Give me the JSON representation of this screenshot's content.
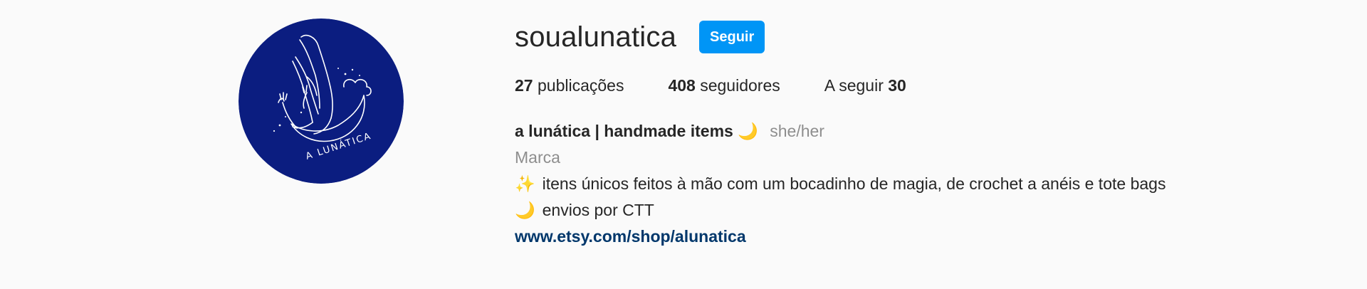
{
  "profile": {
    "username": "soualunatica",
    "follow_label": "Seguir",
    "avatar_text": "A LUNÁTICA",
    "avatar_icon": "moon-woman-logo",
    "stats": {
      "posts_count": "27",
      "posts_label": "publicações",
      "followers_count": "408",
      "followers_label": "seguidores",
      "following_label": "A seguir",
      "following_count": "30"
    },
    "bio": {
      "name": "a lunática | handmade items",
      "name_emoji": "🌙",
      "pronouns": "she/her",
      "category": "Marca",
      "line1_emoji": "✨",
      "line1": "itens únicos feitos à mão com um bocadinho de magia, de crochet a anéis e tote bags",
      "line2_emoji": "🌙",
      "line2": "envios por CTT",
      "link": "www.etsy.com/shop/alunatica"
    }
  },
  "colors": {
    "avatar_bg": "#0b1d80",
    "button_bg": "#0095f6",
    "link": "#00376b",
    "muted": "#8e8e8e",
    "text": "#262626",
    "page_bg": "#fafafa"
  }
}
